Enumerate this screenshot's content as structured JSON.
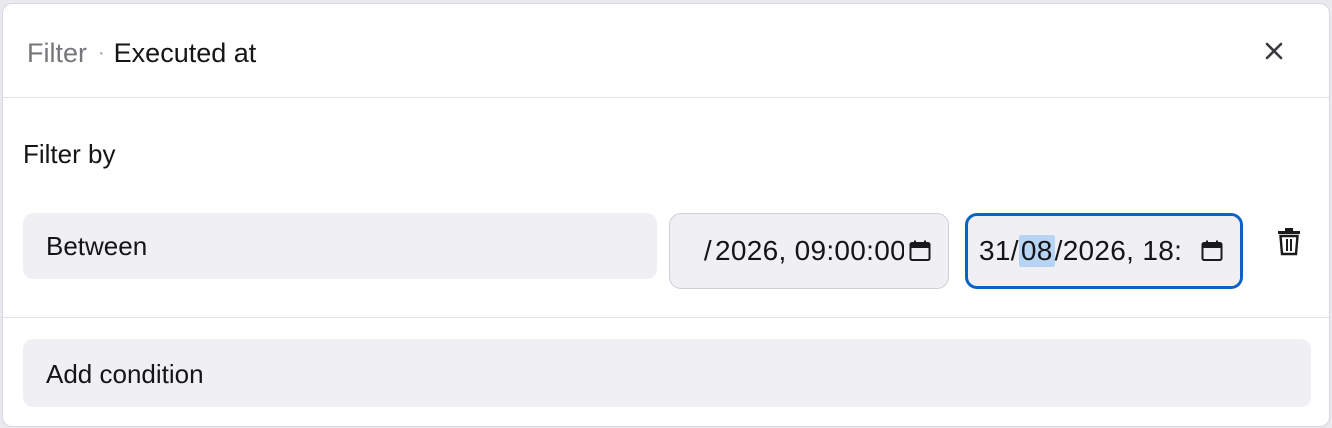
{
  "dialog": {
    "title_prefix": "Filter",
    "title_separator": "·",
    "title_field": "Executed at",
    "close_icon": "close-icon"
  },
  "filter": {
    "label": "Filter by",
    "operator": "Between",
    "date_from": "2026, 09:00:00",
    "date_from_clipped_char": "/",
    "date_to": {
      "day": "31",
      "month": "08",
      "year_time": "2026, 18:",
      "sep": "/"
    },
    "calendar_icon": "calendar-icon",
    "delete_icon": "trash-icon"
  },
  "add_condition_label": "Add condition",
  "colors": {
    "accent": "#0b62c4",
    "highlight": "#b8d4f5",
    "input_bg": "#f0f0f4",
    "muted_text": "#76767b"
  }
}
